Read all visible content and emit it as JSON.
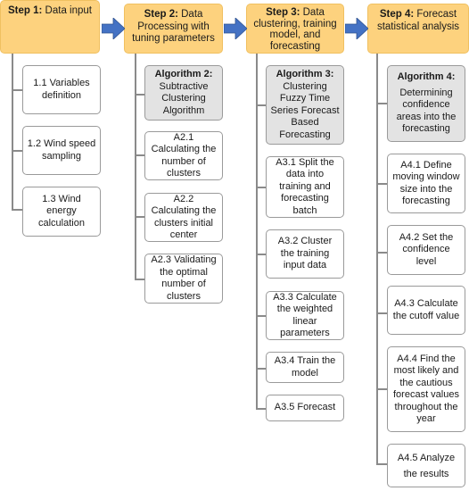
{
  "colors": {
    "step_fill": "#fdd27e",
    "algorithm_fill": "#e3e3e3",
    "arrow": "#4472c4",
    "connector": "#8a8a8a"
  },
  "steps": [
    {
      "label": "Step 1:",
      "title": "Data input",
      "items": [
        "1.1 Variables definition",
        "1.2 Wind speed sampling",
        "1.3 Wind energy calculation"
      ]
    },
    {
      "label": "Step 2:",
      "title": "Data Processing with tuning parameters",
      "algorithm": {
        "label": "Algorithm 2:",
        "title": "Subtractive Clustering Algorithm"
      },
      "items": [
        "A2.1 Calculating the number of clusters",
        "A2.2 Calculating the clusters initial center",
        "A2.3 Validating the optimal number of clusters"
      ]
    },
    {
      "label": "Step 3:",
      "title": "Data clustering, training model, and forecasting",
      "algorithm": {
        "label": "Algorithm 3:",
        "title": "Clustering Fuzzy Time Series Forecast Based Forecasting"
      },
      "items": [
        "A3.1 Split the data into training and forecasting batch",
        "A3.2 Cluster the training input data",
        "A3.3 Calculate the weighted linear parameters",
        "A3.4 Train the model",
        "A3.5 Forecast"
      ]
    },
    {
      "label": "Step 4:",
      "title": "Forecast statistical analysis",
      "algorithm": {
        "label": "Algorithm 4:",
        "title": "Determining confidence areas into the forecasting"
      },
      "items": [
        "A4.1 Define moving window size into the forecasting",
        "A4.2 Set the confidence level",
        "A4.3 Calculate the cutoff value",
        "A4.4 Find the most likely and the cautious forecast values throughout the year",
        "A4.5 Analyze the results"
      ]
    }
  ]
}
